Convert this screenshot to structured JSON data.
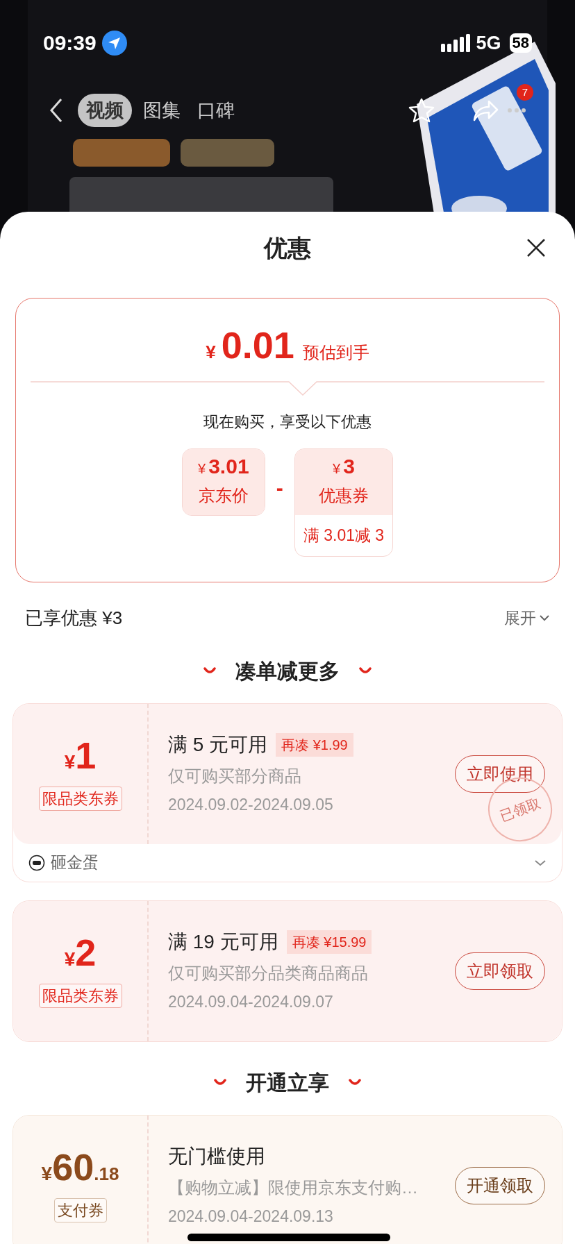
{
  "status_bar": {
    "time": "09:39",
    "network": "5G",
    "battery": "58"
  },
  "nav": {
    "tabs": [
      {
        "label": "视频",
        "selected": true
      },
      {
        "label": "图集",
        "selected": false
      },
      {
        "label": "口碑",
        "selected": false
      }
    ],
    "badge": "7"
  },
  "sheet": {
    "title": "优惠",
    "summary": {
      "currency": "¥",
      "price": "0.01",
      "price_note": "预估到手",
      "subtitle": "现在购买，享受以下优惠",
      "items": [
        {
          "currency": "¥",
          "amount": "3.01",
          "label": "京东价"
        },
        {
          "currency": "¥",
          "amount": "3",
          "label": "优惠券",
          "condition": "满 3.01减 3"
        }
      ],
      "operator": "-"
    },
    "enjoyed": {
      "label": "已享优惠 ¥3",
      "toggle": "展开"
    },
    "sections": [
      {
        "heading": "凑单减更多",
        "coupons": [
          {
            "kind": "category",
            "currency": "¥",
            "amount": "1",
            "tag": "限品类东券",
            "title": "满 5 元可用",
            "extra": "再凑 ¥1.99",
            "desc": "仅可购买部分商品",
            "dates": "2024.09.02-2024.09.05",
            "action": "立即使用",
            "stamp": "已领取",
            "footer": "砸金蛋"
          },
          {
            "kind": "category",
            "currency": "¥",
            "amount": "2",
            "tag": "限品类东券",
            "title": "满 19 元可用",
            "extra": "再凑 ¥15.99",
            "desc": "仅可购买部分品类商品商品",
            "dates": "2024.09.04-2024.09.07",
            "action": "立即领取"
          }
        ]
      },
      {
        "heading": "开通立享",
        "coupons": [
          {
            "kind": "payment",
            "currency": "¥",
            "amount": "60",
            "decimals": ".18",
            "tag": "支付券",
            "title": "无门槛使用",
            "desc": "【购物立减】限使用京东支付购…",
            "dates": "2024.09.04-2024.09.13",
            "action": "开通领取"
          }
        ]
      }
    ]
  }
}
